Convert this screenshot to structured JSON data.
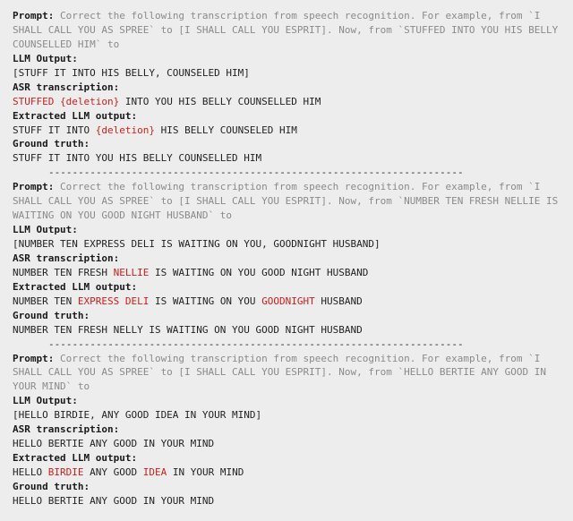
{
  "sep": "----------------------------------------------------------------------",
  "examples": [
    {
      "prompt": [
        {
          "t": "Correct the following transcription from speech recognition. For example, from `I SHALL CALL YOU AS SPREE` to [I SHALL CALL YOU ESPRIT]. Now, from `STUFFED INTO YOU HIS BELLY COUNSELLED HIM` to",
          "c": "grey"
        }
      ],
      "llm": [
        {
          "t": "[STUFF IT INTO HIS BELLY, COUNSELED HIM]",
          "c": ""
        }
      ],
      "asr": [
        {
          "t": "STUFFED {deletion}",
          "c": "red"
        },
        {
          "t": " INTO YOU HIS BELLY COUNSELLED HIM",
          "c": ""
        }
      ],
      "ext": [
        {
          "t": "STUFF IT INTO ",
          "c": ""
        },
        {
          "t": "{deletion}",
          "c": "red"
        },
        {
          "t": " HIS BELLY COUNSELED HIM",
          "c": ""
        }
      ],
      "gt": [
        {
          "t": "STUFF IT INTO YOU HIS BELLY COUNSELLED HIM",
          "c": ""
        }
      ]
    },
    {
      "prompt": [
        {
          "t": "Correct the following transcription from speech recognition. For example, from `I SHALL CALL YOU AS SPREE` to [I SHALL CALL YOU ESPRIT]. Now, from `NUMBER TEN FRESH NELLIE IS WAITING ON YOU GOOD NIGHT HUSBAND` to",
          "c": "grey"
        }
      ],
      "llm": [
        {
          "t": "[NUMBER TEN EXPRESS DELI IS WAITING ON YOU, GOODNIGHT HUSBAND]",
          "c": ""
        }
      ],
      "asr": [
        {
          "t": "NUMBER TEN FRESH ",
          "c": ""
        },
        {
          "t": "NELLIE",
          "c": "red"
        },
        {
          "t": " IS WAITING ON YOU GOOD NIGHT HUSBAND",
          "c": ""
        }
      ],
      "ext": [
        {
          "t": "NUMBER TEN ",
          "c": ""
        },
        {
          "t": "EXPRESS DELI",
          "c": "red"
        },
        {
          "t": " IS WAITING ON YOU ",
          "c": ""
        },
        {
          "t": "GOODNIGHT",
          "c": "red"
        },
        {
          "t": " HUSBAND",
          "c": ""
        }
      ],
      "gt": [
        {
          "t": "NUMBER TEN FRESH NELLY IS WAITING ON YOU GOOD NIGHT HUSBAND",
          "c": ""
        }
      ]
    },
    {
      "prompt": [
        {
          "t": "Correct the following transcription from speech recognition. For example, from `I SHALL CALL YOU AS SPREE` to [I SHALL CALL YOU ESPRIT]. Now, from `HELLO BERTIE ANY GOOD IN YOUR MIND` to",
          "c": "grey"
        }
      ],
      "llm": [
        {
          "t": "[HELLO BIRDIE, ANY GOOD IDEA IN YOUR MIND]",
          "c": ""
        }
      ],
      "asr": [
        {
          "t": "HELLO BERTIE ANY GOOD IN YOUR MIND",
          "c": ""
        }
      ],
      "ext": [
        {
          "t": "HELLO ",
          "c": ""
        },
        {
          "t": "BIRDIE",
          "c": "red"
        },
        {
          "t": " ANY GOOD ",
          "c": ""
        },
        {
          "t": "IDEA",
          "c": "red"
        },
        {
          "t": " IN YOUR MIND",
          "c": ""
        }
      ],
      "gt": [
        {
          "t": "HELLO BERTIE ANY GOOD IN YOUR MIND",
          "c": ""
        }
      ]
    }
  ],
  "labels": {
    "prompt": "Prompt: ",
    "llm": "LLM Output:",
    "asr": "ASR transcription:",
    "ext": "Extracted LLM output:",
    "gt": "Ground truth:"
  }
}
